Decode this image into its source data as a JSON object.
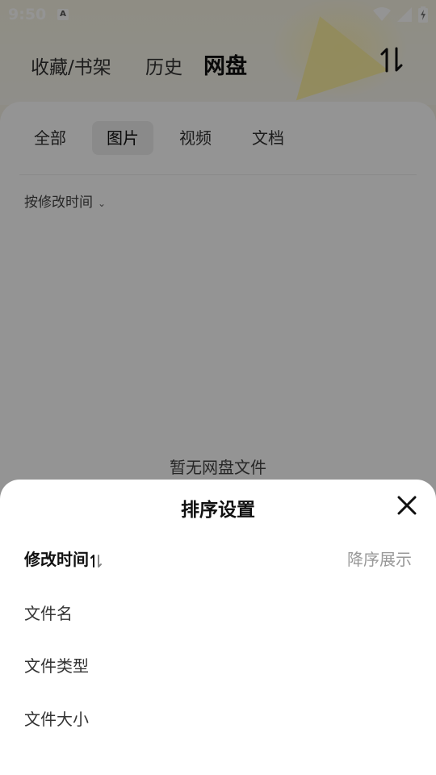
{
  "status_bar": {
    "time": "9:50",
    "app_badge": "A",
    "icons": [
      "wifi-icon",
      "signal-icon",
      "battery-charging-icon"
    ]
  },
  "top_tabs": [
    {
      "label": "收藏/书架",
      "active": false
    },
    {
      "label": "历史",
      "active": false
    },
    {
      "label": "网盘",
      "active": true
    }
  ],
  "type_tabs": [
    {
      "label": "全部",
      "active": false
    },
    {
      "label": "图片",
      "active": true
    },
    {
      "label": "视频",
      "active": false
    },
    {
      "label": "文档",
      "active": false
    }
  ],
  "filter": {
    "label": "按修改时间"
  },
  "empty_state": {
    "text": "暂无网盘文件"
  },
  "sort_sheet": {
    "title": "排序设置",
    "options": [
      {
        "label": "修改时间",
        "selected": true,
        "hint": "降序展示"
      },
      {
        "label": "文件名",
        "selected": false
      },
      {
        "label": "文件类型",
        "selected": false
      },
      {
        "label": "文件大小",
        "selected": false
      }
    ]
  },
  "colors": {
    "scrim": "#000000",
    "sheet_bg": "#ffffff",
    "hint_text": "#999999",
    "bg_accent": "#fcef9c"
  }
}
